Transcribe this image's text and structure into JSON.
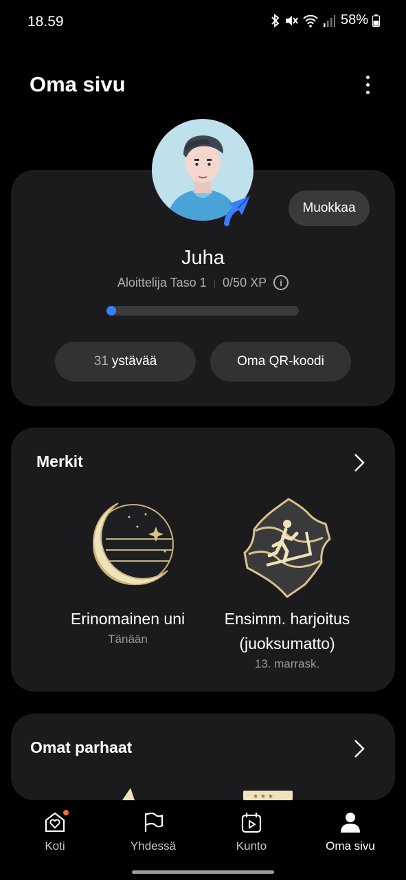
{
  "status_bar": {
    "time": "18.59",
    "battery": "58%"
  },
  "header": {
    "title": "Oma sivu"
  },
  "profile": {
    "edit_label": "Muokkaa",
    "name": "Juha",
    "level": "Aloittelija Taso 1",
    "xp": "0/50 XP",
    "xp_progress": 0.05,
    "friends_count": "31",
    "friends_label": "ystävää",
    "qr_label": "Oma QR-koodi"
  },
  "badges": {
    "title": "Merkit",
    "items": [
      {
        "title": "Erinomainen uni",
        "date": "Tänään",
        "icon": "moon-badge-icon"
      },
      {
        "title": "Ensimm. harjoitus (juoksumatto)",
        "date": "13. marrask.",
        "icon": "treadmill-badge-icon"
      }
    ]
  },
  "personal_best": {
    "title": "Omat parhaat"
  },
  "colors": {
    "accent": "#3b7dff",
    "card": "#1b1b1d",
    "notification": "#ff6a3d"
  },
  "nav": {
    "items": [
      {
        "label": "Koti",
        "icon": "home-heart-icon"
      },
      {
        "label": "Yhdessä",
        "icon": "flag-icon"
      },
      {
        "label": "Kunto",
        "icon": "fitness-calendar-icon"
      },
      {
        "label": "Oma sivu",
        "icon": "person-icon"
      }
    ]
  }
}
